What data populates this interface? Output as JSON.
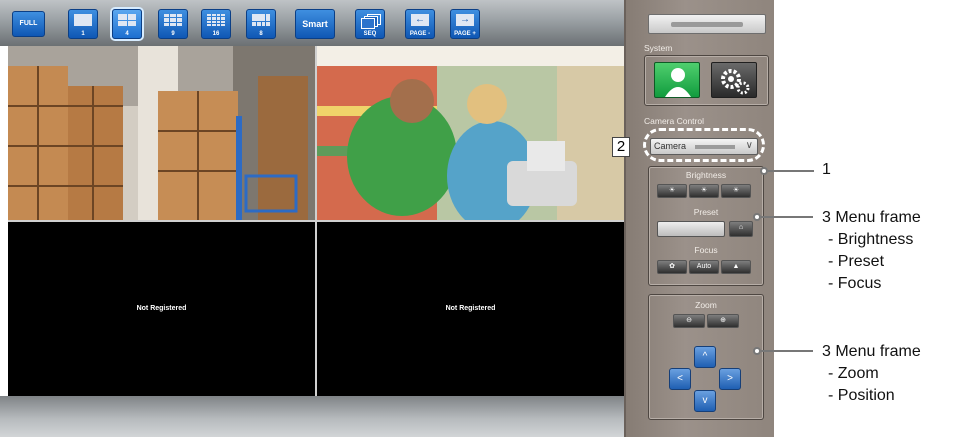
{
  "toolbar": {
    "full_label": "FULL",
    "layout_buttons": [
      {
        "label": "1"
      },
      {
        "label": "4"
      },
      {
        "label": "9"
      },
      {
        "label": "16"
      },
      {
        "label": "8"
      }
    ],
    "smart_label": "Smart",
    "seq_label": "SEQ",
    "page_prev_label": "PAGE -",
    "page_next_label": "PAGE +"
  },
  "video": {
    "cells": [
      {
        "status": ""
      },
      {
        "status": ""
      },
      {
        "status": "Not Registered"
      },
      {
        "status": "Not Registered"
      }
    ]
  },
  "side": {
    "system_label": "System",
    "camera_control_label": "Camera Control",
    "camera_select_label": "Camera",
    "brightness_label": "Brightness",
    "preset_label": "Preset",
    "focus_label": "Focus",
    "focus_auto_label": "Auto",
    "zoom_label": "Zoom",
    "pan_up": "^",
    "pan_left": "<",
    "pan_right": ">",
    "pan_down": "v"
  },
  "annotations": {
    "num_2": "2",
    "num_1": "1",
    "menu1_title": "3 Menu frame",
    "menu1_items": [
      "- Brightness",
      "- Preset",
      "- Focus"
    ],
    "menu2_title": "3 Menu frame",
    "menu2_items": [
      "- Zoom",
      "- Position"
    ]
  },
  "colors": {
    "toolbar_button": "#1565c0",
    "system_user_active": "#1aa34a",
    "side_panel": "#948a83"
  }
}
